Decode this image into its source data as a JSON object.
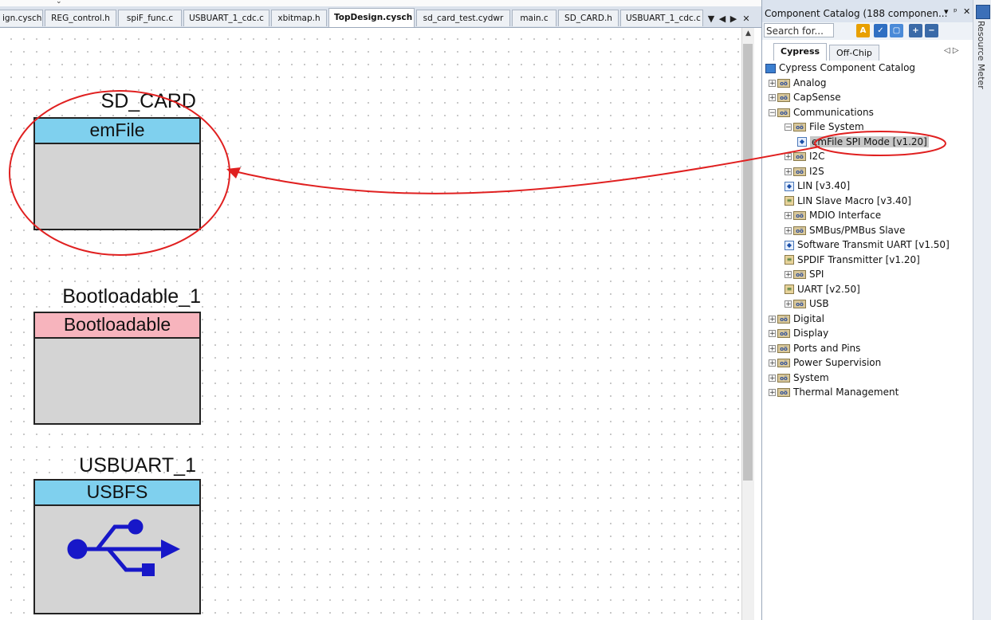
{
  "doc_tabs": {
    "items": [
      {
        "label": "ign.cysch",
        "active": false
      },
      {
        "label": "REG_control.h",
        "active": false
      },
      {
        "label": "spiF_func.c",
        "active": false
      },
      {
        "label": "USBUART_1_cdc.c",
        "active": false
      },
      {
        "label": "xbitmap.h",
        "active": false
      },
      {
        "label": "TopDesign.cysch",
        "active": true
      },
      {
        "label": "sd_card_test.cydwr",
        "active": false
      },
      {
        "label": "main.c",
        "active": false
      },
      {
        "label": "SD_CARD.h",
        "active": false
      },
      {
        "label": "USBUART_1_cdc.c",
        "active": false
      }
    ],
    "controls": [
      "▼",
      "◀",
      "▶",
      "✕"
    ]
  },
  "canvas": {
    "components": [
      {
        "instance_name": "SD_CARD",
        "type_label": "emFile",
        "header_color": "#7fd0ee"
      },
      {
        "instance_name": "Bootloadable_1",
        "type_label": "Bootloadable",
        "header_color": "#f7b4bd"
      },
      {
        "instance_name": "USBUART_1",
        "type_label": "USBFS",
        "header_color": "#7fd0ee"
      }
    ],
    "annotation_color": "#e02020",
    "usb_color": "#1717c8"
  },
  "catalog": {
    "title": "Component Catalog (188 componen...",
    "title_controls": [
      "▾",
      "ᵖ",
      "✕"
    ],
    "search_placeholder": "Search for...",
    "tabs": [
      {
        "label": "Cypress",
        "active": true
      },
      {
        "label": "Off-Chip",
        "active": false
      }
    ],
    "tab_controls": "◁ ▷",
    "tree": [
      {
        "label": "Cypress Component Catalog",
        "level": 0,
        "kind": "root",
        "exp": ""
      },
      {
        "label": "Analog",
        "level": 1,
        "kind": "folder",
        "exp": "+"
      },
      {
        "label": "CapSense",
        "level": 1,
        "kind": "folder",
        "exp": "+"
      },
      {
        "label": "Communications",
        "level": 1,
        "kind": "folder",
        "exp": "−"
      },
      {
        "label": "File System",
        "level": 2,
        "kind": "folder",
        "exp": "−"
      },
      {
        "label": "emFile SPI Mode [v1.20]",
        "level": 3,
        "kind": "comp",
        "exp": "",
        "selected": true
      },
      {
        "label": "I2C",
        "level": 2,
        "kind": "folder",
        "exp": "+"
      },
      {
        "label": "I2S",
        "level": 2,
        "kind": "folder",
        "exp": "+"
      },
      {
        "label": "LIN [v3.40]",
        "level": 2,
        "kind": "comp",
        "exp": ""
      },
      {
        "label": "LIN Slave Macro [v3.40]",
        "level": 2,
        "kind": "macro",
        "exp": ""
      },
      {
        "label": "MDIO Interface",
        "level": 2,
        "kind": "folder",
        "exp": "+"
      },
      {
        "label": "SMBus/PMBus Slave",
        "level": 2,
        "kind": "folder",
        "exp": "+"
      },
      {
        "label": "Software Transmit UART [v1.50]",
        "level": 2,
        "kind": "comp",
        "exp": ""
      },
      {
        "label": "SPDIF Transmitter [v1.20]",
        "level": 2,
        "kind": "macro",
        "exp": ""
      },
      {
        "label": "SPI",
        "level": 2,
        "kind": "folder",
        "exp": "+"
      },
      {
        "label": "UART [v2.50]",
        "level": 2,
        "kind": "macro",
        "exp": ""
      },
      {
        "label": "USB",
        "level": 2,
        "kind": "folder",
        "exp": "+"
      },
      {
        "label": "Digital",
        "level": 1,
        "kind": "folder",
        "exp": "+"
      },
      {
        "label": "Display",
        "level": 1,
        "kind": "folder",
        "exp": "+"
      },
      {
        "label": "Ports and Pins",
        "level": 1,
        "kind": "folder",
        "exp": "+"
      },
      {
        "label": "Power Supervision",
        "level": 1,
        "kind": "folder",
        "exp": "+"
      },
      {
        "label": "System",
        "level": 1,
        "kind": "folder",
        "exp": "+"
      },
      {
        "label": "Thermal Management",
        "level": 1,
        "kind": "folder",
        "exp": "+"
      }
    ]
  },
  "side_rail": {
    "label": "Resource Meter"
  }
}
